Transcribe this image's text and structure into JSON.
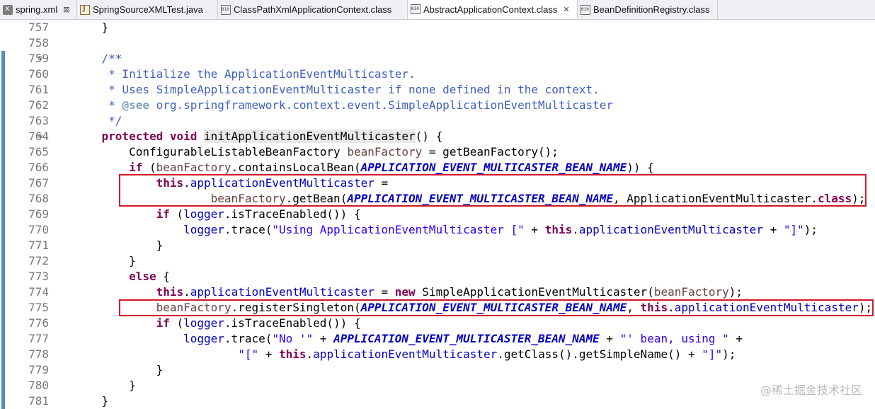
{
  "tabs": [
    {
      "label": "spring.xml",
      "icon": "xml-file-icon",
      "close": "⊠"
    },
    {
      "label": "SpringSourceXMLTest.java",
      "icon": "java-file-icon"
    },
    {
      "label": "ClassPathXmlApplicationContext.class",
      "icon": "class-file-icon"
    },
    {
      "label": "AbstractApplicationContext.class",
      "icon": "class-file-icon",
      "close": "✕"
    },
    {
      "label": "BeanDefinitionRegistry.class",
      "icon": "class-file-icon"
    }
  ],
  "lines": [
    {
      "n": "757"
    },
    {
      "n": "758"
    },
    {
      "n": "759",
      "fold": "⊖"
    },
    {
      "n": "760"
    },
    {
      "n": "761"
    },
    {
      "n": "762"
    },
    {
      "n": "763"
    },
    {
      "n": "764",
      "fold": "⊖"
    },
    {
      "n": "765"
    },
    {
      "n": "766"
    },
    {
      "n": "767"
    },
    {
      "n": "768"
    },
    {
      "n": "769"
    },
    {
      "n": "770"
    },
    {
      "n": "771"
    },
    {
      "n": "772"
    },
    {
      "n": "773"
    },
    {
      "n": "774"
    },
    {
      "n": "775"
    },
    {
      "n": "776"
    },
    {
      "n": "777"
    },
    {
      "n": "778"
    },
    {
      "n": "779"
    },
    {
      "n": "780"
    },
    {
      "n": "781"
    }
  ],
  "code": {
    "l757": {
      "t1": "    }"
    },
    "l758": {},
    "l759": {
      "t1": "    /**"
    },
    "l760": {
      "t1": "     * Initialize the ApplicationEventMulticaster."
    },
    "l761": {
      "t1": "     * Uses SimpleApplicationEventMulticaster if none defined in the context."
    },
    "l762": {
      "t1": "     * ",
      "tag": "@see",
      "t2": " org.springframework.context.event.SimpleApplicationEventMulticaster"
    },
    "l763": {
      "t1": "     */"
    },
    "l764": {
      "t0": "    ",
      "kw1": "protected",
      "sp": " ",
      "kw2": "void",
      "sp2": " ",
      "m": "initApplicationEventMulticaster",
      "t1": "() {"
    },
    "l765": {
      "t1": "        ConfigurableListableBeanFactory ",
      "v": "beanFactory",
      "t2": " = getBeanFactory();"
    },
    "l766": {
      "t0": "        ",
      "kw": "if",
      "t1": " (",
      "v": "beanFactory",
      "t2": ".containsLocalBean(",
      "c": "APPLICATION_EVENT_MULTICASTER_BEAN_NAME",
      "t3": ")) {"
    },
    "l767": {
      "t0": "            ",
      "kw": "this",
      "t1": ".",
      "f": "applicationEventMulticaster",
      "t2": " ="
    },
    "l768": {
      "t0": "                    ",
      "v": "beanFactory",
      "t1": ".getBean(",
      "c": "APPLICATION_EVENT_MULTICASTER_BEAN_NAME",
      "t2": ", ApplicationEventMulticaster.",
      "kw": "class",
      "t3": ");"
    },
    "l769": {
      "t0": "            ",
      "kw": "if",
      "t1": " (",
      "f": "logger",
      "t2": ".isTraceEnabled()) {"
    },
    "l770": {
      "t0": "                ",
      "f": "logger",
      "t1": ".trace(",
      "s1": "\"Using ApplicationEventMulticaster [\"",
      "t2": " + ",
      "kw": "this",
      "t3": ".",
      "f2": "applicationEventMulticaster",
      "t4": " + ",
      "s2": "\"]\"",
      "t5": ");"
    },
    "l771": {
      "t1": "            }"
    },
    "l772": {
      "t1": "        }"
    },
    "l773": {
      "t0": "        ",
      "kw": "else",
      "t1": " {"
    },
    "l774": {
      "t0": "            ",
      "kw": "this",
      "t1": ".",
      "f": "applicationEventMulticaster",
      "t2": " = ",
      "kw2": "new",
      "t3": " SimpleApplicationEventMulticaster(",
      "v": "beanFactory",
      "t4": ");"
    },
    "l775": {
      "t0": "            ",
      "v": "beanFactory",
      "t1": ".registerSingleton(",
      "c": "APPLICATION_EVENT_MULTICASTER_BEAN_NAME",
      "t2": ", ",
      "kw": "this",
      "t3": ".",
      "f": "applicationEventMulticaster",
      "t4": ");"
    },
    "l776": {
      "t0": "            ",
      "kw": "if",
      "t1": " (",
      "f": "logger",
      "t2": ".isTraceEnabled()) {"
    },
    "l777": {
      "t0": "                ",
      "f": "logger",
      "t1": ".trace(",
      "s1": "\"No '\"",
      "t2": " + ",
      "c": "APPLICATION_EVENT_MULTICASTER_BEAN_NAME",
      "t3": " + ",
      "s2": "\"' bean, using \"",
      "t4": " +"
    },
    "l778": {
      "t0": "                        ",
      "s1": "\"[\"",
      "t1": " + ",
      "kw": "this",
      "t2": ".",
      "f": "applicationEventMulticaster",
      "t3": ".getClass().getSimpleName() + ",
      "s2": "\"]\"",
      "t4": ");"
    },
    "l779": {
      "t1": "            }"
    },
    "l780": {
      "t1": "        }"
    },
    "l781": {
      "t1": "    }"
    }
  },
  "watermark": "@稀土掘金技术社区",
  "colors": {
    "keyword": "#7f0055",
    "comment": "#3f5fbf",
    "field": "#0000c0",
    "string": "#2a00ff",
    "highlight_box": "#d3162a"
  }
}
